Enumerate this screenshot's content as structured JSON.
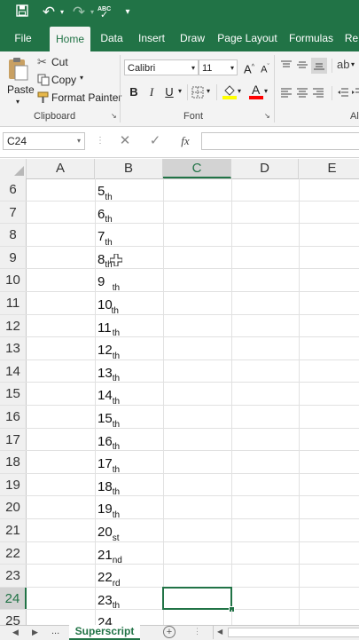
{
  "qat": {
    "abc_label": "ABC"
  },
  "tabs": [
    "File",
    "Home",
    "Data",
    "Insert",
    "Draw",
    "Page Layout",
    "Formulas",
    "Re"
  ],
  "active_tab": "Home",
  "clipboard": {
    "paste": "Paste",
    "cut": "Cut",
    "copy": "Copy",
    "format_painter": "Format Painter",
    "group_title": "Clipboard"
  },
  "font": {
    "name": "Calibri",
    "size": "11",
    "bold": "B",
    "italic": "I",
    "underline": "U",
    "grow": "A",
    "shrink": "A",
    "color_letter": "A",
    "group_title": "Font",
    "fill_color": "#FFFF00",
    "font_color": "#FF0000"
  },
  "alignment": {
    "group_title_partial": "Al"
  },
  "formula_bar": {
    "name_box": "C24",
    "fx": "fx",
    "formula": ""
  },
  "columns": [
    "A",
    "B",
    "C",
    "D",
    "E"
  ],
  "selected_column": "C",
  "rows": [
    {
      "num": "6",
      "b_main": "5",
      "b_sup": "th"
    },
    {
      "num": "7",
      "b_main": "6",
      "b_sup": "th"
    },
    {
      "num": "8",
      "b_main": "7",
      "b_sup": "th"
    },
    {
      "num": "9",
      "b_main": "8",
      "b_sup": "th"
    },
    {
      "num": "10",
      "b_main": "9",
      "b_sup": "th"
    },
    {
      "num": "11",
      "b_main": "10",
      "b_sup": "th"
    },
    {
      "num": "12",
      "b_main": "11",
      "b_sup": "th"
    },
    {
      "num": "13",
      "b_main": "12",
      "b_sup": "th"
    },
    {
      "num": "14",
      "b_main": "13",
      "b_sup": "th"
    },
    {
      "num": "15",
      "b_main": "14",
      "b_sup": "th"
    },
    {
      "num": "16",
      "b_main": "15",
      "b_sup": "th"
    },
    {
      "num": "17",
      "b_main": "16",
      "b_sup": "th"
    },
    {
      "num": "18",
      "b_main": "17",
      "b_sup": "th"
    },
    {
      "num": "19",
      "b_main": "18",
      "b_sup": "th"
    },
    {
      "num": "20",
      "b_main": "19",
      "b_sup": "th"
    },
    {
      "num": "21",
      "b_main": "20",
      "b_sup": "th"
    },
    {
      "num": "22",
      "b_main": "21",
      "b_sup": "st"
    },
    {
      "num": "23",
      "b_main": "22",
      "b_sup": "nd"
    },
    {
      "num": "24",
      "b_main": "23",
      "b_sup": "rd"
    },
    {
      "num": "25",
      "b_main": "24",
      "b_sup": "th"
    }
  ],
  "selected_row": "24",
  "sheets": {
    "ellipsis": "...",
    "active": "Superscript",
    "add": "+"
  },
  "colors": {
    "accent": "#217346",
    "ribbon_bg": "#F3F3F3",
    "header_bg": "#F0F0F0"
  },
  "icons": [
    "save-icon",
    "undo-icon",
    "redo-icon",
    "spelling-icon",
    "customize-qat-icon",
    "cut-icon",
    "copy-icon",
    "format-painter-icon",
    "paste-icon",
    "borders-icon",
    "fill-color-icon",
    "font-color-icon",
    "cancel-icon",
    "enter-icon",
    "move-cursor-icon",
    "add-sheet-icon"
  ]
}
